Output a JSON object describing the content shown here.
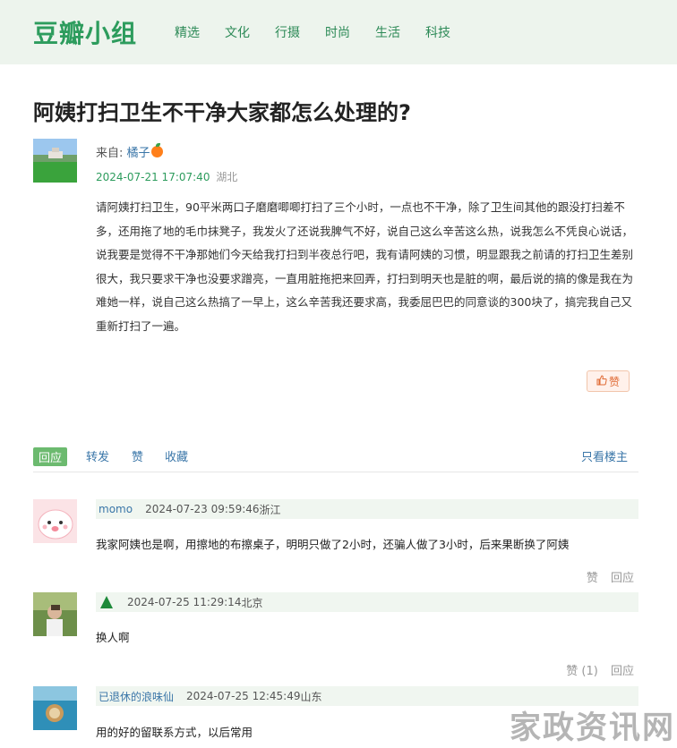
{
  "header": {
    "logo": "豆瓣小组",
    "nav": [
      "精选",
      "文化",
      "行摄",
      "时尚",
      "生活",
      "科技"
    ]
  },
  "post": {
    "title": "阿姨打扫卫生不干净大家都怎么处理的?",
    "from_label": "来自:",
    "author": "橘子",
    "time": "2024-07-21 17:07:40",
    "location": "湖北",
    "body": "请阿姨打扫卫生，90平米两口子磨磨唧唧打扫了三个小时，一点也不干净，除了卫生间其他的跟没打扫差不多，还用拖了地的毛巾抹凳子，我发火了还说我脾气不好，说自己这么辛苦这么热，说我怎么不凭良心说话，说我要是觉得不干净那她们今天给我打扫到半夜总行吧，我有请阿姨的习惯，明显跟我之前请的打扫卫生差别很大，我只要求干净也没要求蹭亮，一直用脏拖把来回弄，打扫到明天也是脏的啊，最后说的搞的像是我在为难她一样，说自己这么热搞了一早上，这么辛苦我还要求高，我委屈巴巴的同意谈的300块了，搞完我自己又重新打扫了一遍。",
    "like_label": "赞"
  },
  "actions": {
    "reply": "回应",
    "forward": "转发",
    "like": "赞",
    "collect": "收藏",
    "only_op": "只看楼主"
  },
  "comments": [
    {
      "name": "momo",
      "time": "2024-07-23 09:59:46",
      "location": "浙江",
      "text": "我家阿姨也是啊，用擦地的布擦桌子，明明只做了2小时，还骗人做了3小时，后来果断换了阿姨",
      "like": "赞",
      "reply": "回应"
    },
    {
      "name": "",
      "time": "2024-07-25 11:29:14",
      "location": "北京",
      "text": "换人啊",
      "like": "赞 (1)",
      "reply": "回应"
    },
    {
      "name": "已退休的浪味仙",
      "time": "2024-07-25 12:45:49",
      "location": "山东",
      "text": "用的好的留联系方式，以后常用"
    }
  ],
  "watermark": "家政资讯网"
}
